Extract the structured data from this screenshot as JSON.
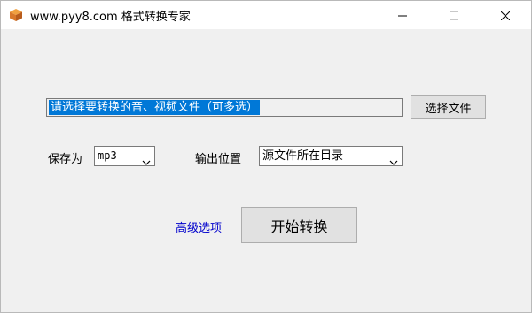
{
  "window": {
    "title": "www.pyy8.com 格式转换专家",
    "icon": "package-box-icon",
    "controls": [
      "minimize-icon",
      "maximize-icon",
      "close-icon"
    ]
  },
  "file_select": {
    "value": "请选择要转换的音、视频文件（可多选）",
    "button_label": "选择文件"
  },
  "save_as": {
    "label": "保存为",
    "selected": "mp3"
  },
  "output_location": {
    "label": "输出位置",
    "selected": "源文件所在目录"
  },
  "actions": {
    "advanced_link": "高级选项",
    "start_button": "开始转换"
  },
  "colors": {
    "selection": "#0078d7",
    "link": "#0000cc",
    "background": "#f0f0f0",
    "titlebar": "#ffffff"
  }
}
